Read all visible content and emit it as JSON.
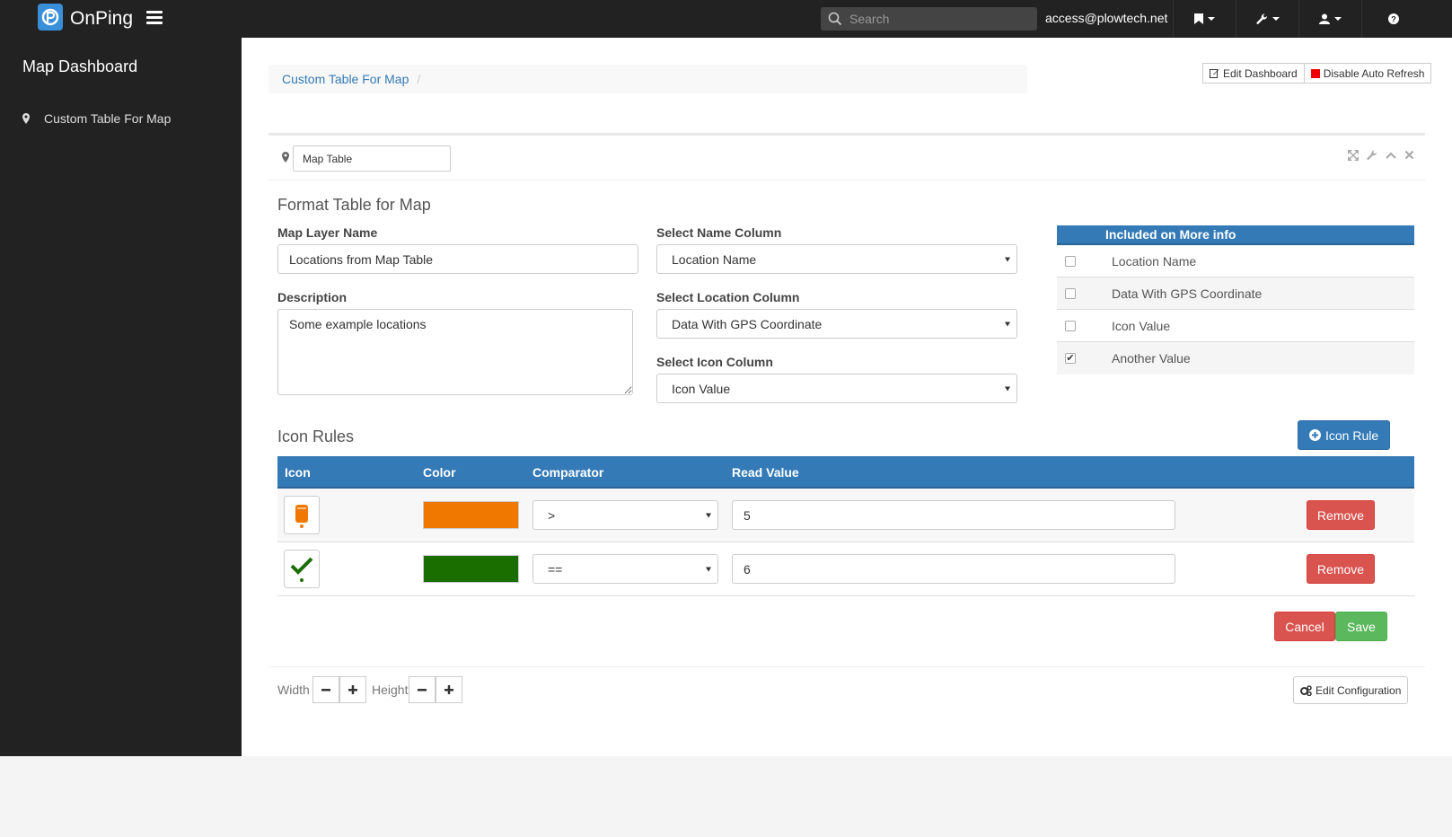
{
  "app": {
    "name": "OnPing",
    "logo_icon": "onping-logo-icon",
    "accent_color": "#3a8fd9"
  },
  "topbar": {
    "search_placeholder": "Search",
    "user_email": "access@plowtech.net",
    "bookmark_icon": "bookmark-icon",
    "tools_icon": "wrench-icon",
    "user_icon": "user-icon",
    "help_icon": "question-circle-icon"
  },
  "sidebar": {
    "title": "Map Dashboard",
    "items": [
      {
        "label": "Custom Table For Map",
        "icon": "map-marker-icon"
      }
    ]
  },
  "breadcrumb": {
    "items": [
      "Custom Table For Map"
    ],
    "separator": "/"
  },
  "top_actions": {
    "edit_dashboard": "Edit Dashboard",
    "disable_auto_refresh": "Disable Auto Refresh"
  },
  "widget": {
    "title_value": "Map Table",
    "format_section_title": "Format Table for Map",
    "map_layer_name_label": "Map Layer Name",
    "map_layer_name_value": "Locations from Map Table",
    "description_label": "Description",
    "description_value": "Some example locations",
    "name_column_label": "Select Name Column",
    "name_column_value": "Location Name",
    "location_column_label": "Select Location Column",
    "location_column_value": "Data With GPS Coordinate",
    "icon_column_label": "Select Icon Column",
    "icon_column_value": "Icon Value",
    "more_info": {
      "header": "Included on More info",
      "rows": [
        {
          "label": "Location Name",
          "checked": false
        },
        {
          "label": "Data With GPS Coordinate",
          "checked": false
        },
        {
          "label": "Icon Value",
          "checked": false
        },
        {
          "label": "Another Value",
          "checked": true
        }
      ]
    },
    "icon_rules": {
      "title": "Icon Rules",
      "add_button": "Icon Rule",
      "headers": {
        "icon": "Icon",
        "color": "Color",
        "comparator": "Comparator",
        "read_value": "Read Value"
      },
      "rows": [
        {
          "icon": "tank-icon",
          "icon_color": "#f07800",
          "color": "#f07800",
          "comparator": ">",
          "read_value": "5",
          "remove": "Remove"
        },
        {
          "icon": "check-icon",
          "icon_color": "#1a6e00",
          "color": "#1a6e00",
          "comparator": "==",
          "read_value": "6",
          "remove": "Remove"
        }
      ]
    },
    "cancel_label": "Cancel",
    "save_label": "Save",
    "footer": {
      "width_label": "Width",
      "height_label": "Height",
      "edit_config_label": "Edit Configuration"
    }
  }
}
